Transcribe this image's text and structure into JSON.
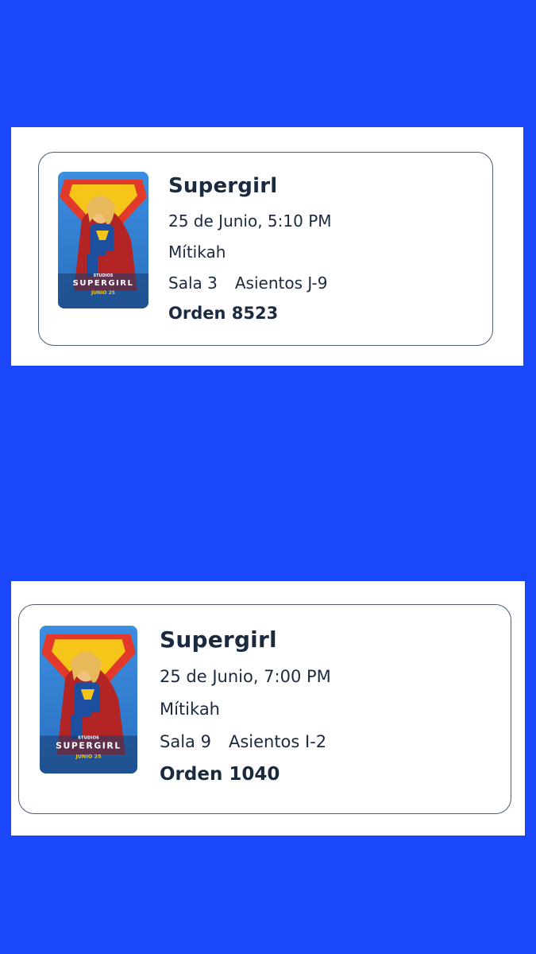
{
  "colors": {
    "background": "#1a47fb",
    "panel": "#ffffff",
    "card_border": "#4a5b74",
    "text": "#1b2a3f"
  },
  "tickets": [
    {
      "poster": {
        "icon": "supergirl-poster-image",
        "studio": "STUDIOS",
        "movie": "SUPERGIRL",
        "release": "JUNIO 25"
      },
      "title": "Supergirl",
      "datetime": "25 de Junio, 5:10 PM",
      "location": "Mítikah",
      "room": "Sala 3",
      "seats": "Asientos J-9",
      "order": "Orden 8523"
    },
    {
      "poster": {
        "icon": "supergirl-poster-image",
        "studio": "STUDIOS",
        "movie": "SUPERGIRL",
        "release": "JUNIO 25"
      },
      "title": "Supergirl",
      "datetime": "25 de Junio, 7:00 PM",
      "location": "Mítikah",
      "room": "Sala 9",
      "seats": "Asientos I-2",
      "order": "Orden 1040"
    }
  ]
}
